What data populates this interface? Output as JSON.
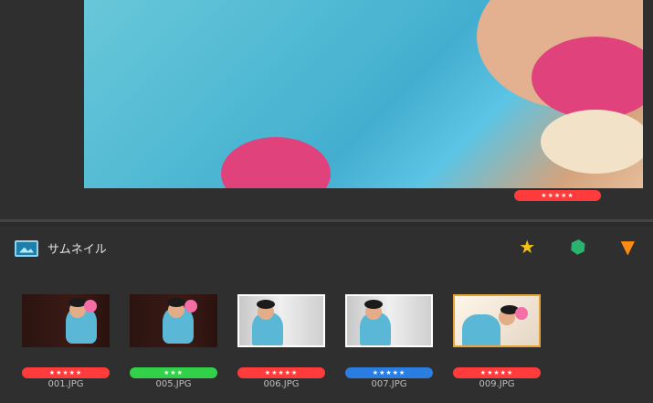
{
  "preview": {
    "rating_stars": "★★★★★"
  },
  "thumbnail_panel": {
    "title": "サムネイル",
    "tools": [
      "star-icon",
      "tag-icon",
      "filter-icon"
    ]
  },
  "thumbnails": [
    {
      "name": "001.JPG",
      "rating": "★★★★★",
      "color": "#ff3b3b"
    },
    {
      "name": "005.JPG",
      "rating": "★★★",
      "color": "#33d14a"
    },
    {
      "name": "006.JPG",
      "rating": "★★★★★",
      "color": "#ff3b3b"
    },
    {
      "name": "007.JPG",
      "rating": "★★★★★",
      "color": "#2a7de1"
    },
    {
      "name": "009.JPG",
      "rating": "★★★★★",
      "color": "#ff3b3b"
    }
  ]
}
